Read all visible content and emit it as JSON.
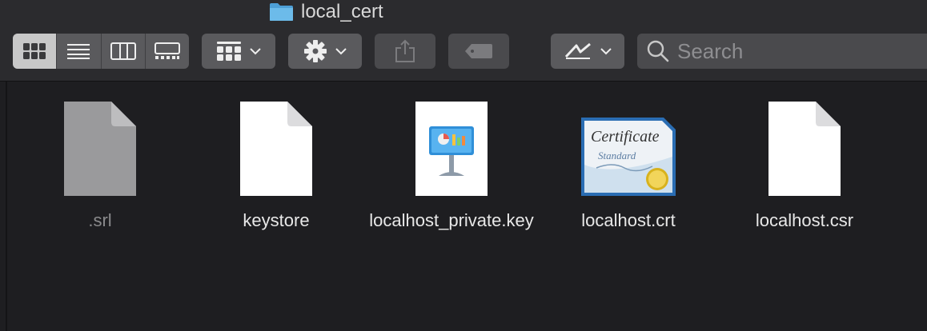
{
  "window": {
    "title": "local_cert"
  },
  "toolbar": {
    "view_modes": [
      "icon-view",
      "list-view",
      "column-view",
      "gallery-view"
    ],
    "active_view": "icon-view",
    "search_placeholder": "Search"
  },
  "files": [
    {
      "name": ".srl",
      "icon": "generic-file-icon-dimmed",
      "dimmed": true
    },
    {
      "name": "keystore",
      "icon": "generic-file-icon",
      "dimmed": false
    },
    {
      "name": "localhost_private.key",
      "icon": "keynote-file-icon",
      "dimmed": false
    },
    {
      "name": "localhost.crt",
      "icon": "certificate-icon",
      "cert_text": [
        "Certificate",
        "Standard"
      ],
      "dimmed": false
    },
    {
      "name": "localhost.csr",
      "icon": "generic-file-icon",
      "dimmed": false
    }
  ],
  "colors": {
    "background": "#1e1e21",
    "toolbar": "#2b2b2e",
    "button": "#5a5a5d",
    "folder_blue": "#5aaee0"
  }
}
